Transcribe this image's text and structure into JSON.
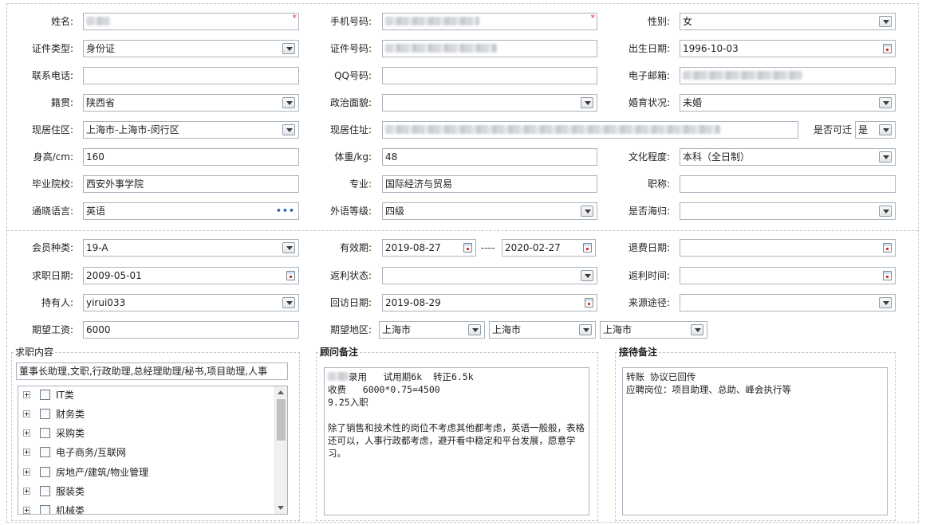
{
  "colors": {
    "border": "#a9b4bf",
    "required": "#e03030",
    "dashed": "#c8c8c8"
  },
  "basic": {
    "name_label": "姓名:",
    "mobile_label": "手机号码:",
    "gender_label": "性别:",
    "gender_value": "女",
    "id_type_label": "证件类型:",
    "id_type_value": "身份证",
    "id_number_label": "证件号码:",
    "birth_label": "出生日期:",
    "birth_value": "1996-10-03",
    "phone_label": "联系电话:",
    "qq_label": "QQ号码:",
    "email_label": "电子邮箱:",
    "native_label": "籍贯:",
    "native_value": "陕西省",
    "political_label": "政治面貌:",
    "marital_label": "婚育状况:",
    "marital_value": "未婚",
    "residence_label": "现居住区:",
    "residence_value": "上海市-上海市-闵行区",
    "address_label": "现居住址:",
    "relocate_label": "是否可迁",
    "relocate_value": "是",
    "height_label": "身高/cm:",
    "height_value": "160",
    "weight_label": "体重/kg:",
    "weight_value": "48",
    "education_label": "文化程度:",
    "education_value": "本科（全日制）",
    "school_label": "毕业院校:",
    "school_value": "西安外事学院",
    "major_label": "专业:",
    "major_value": "国际经济与贸易",
    "title_label": "职称:",
    "language_label": "通晓语言:",
    "language_value": "英语",
    "language_more": "•••",
    "level_label": "外语等级:",
    "level_value": "四级",
    "overseas_label": "是否海归:"
  },
  "member": {
    "type_label": "会员种类:",
    "type_value": "19-A",
    "valid_label": "有效期:",
    "valid_from": "2019-08-27",
    "valid_sep": "----",
    "valid_to": "2020-02-27",
    "refund_label": "退费日期:",
    "seek_label": "求职日期:",
    "seek_value": "2009-05-01",
    "rebate_status_label": "返利状态:",
    "rebate_time_label": "返利时间:",
    "holder_label": "持有人:",
    "holder_value": "yirui033",
    "visit_label": "回访日期:",
    "visit_value": "2019-08-29",
    "source_label": "来源途径:",
    "salary_label": "期望工资:",
    "salary_value": "6000",
    "region_label": "期望地区:",
    "region_1": "上海市",
    "region_2": "上海市",
    "region_3": "上海市"
  },
  "job_content": {
    "legend": "求职内容",
    "summary": "董事长助理,文职,行政助理,总经理助理/秘书,项目助理,人事",
    "tree": [
      {
        "label": "IT类"
      },
      {
        "label": "财务类"
      },
      {
        "label": "采购类"
      },
      {
        "label": "电子商务/互联网"
      },
      {
        "label": "房地产/建筑/物业管理"
      },
      {
        "label": "服装类"
      },
      {
        "label": "机械类"
      }
    ]
  },
  "consultant": {
    "legend": "顾问备注",
    "text_line1": "录用   试用期6k  转正6.5k",
    "text_rest": "收费   6000*0.75=4500\n9.25入职\n\n除了销售和技术性的岗位不考虑其他都考虑，英语一般般，表格还可以，人事行政都考虑，避开看中稳定和平台发展，愿意学习。"
  },
  "reception": {
    "legend": "接待备注",
    "text": "转账 协议已回传\n应聘岗位：项目助理、总助、峰会执行等"
  }
}
